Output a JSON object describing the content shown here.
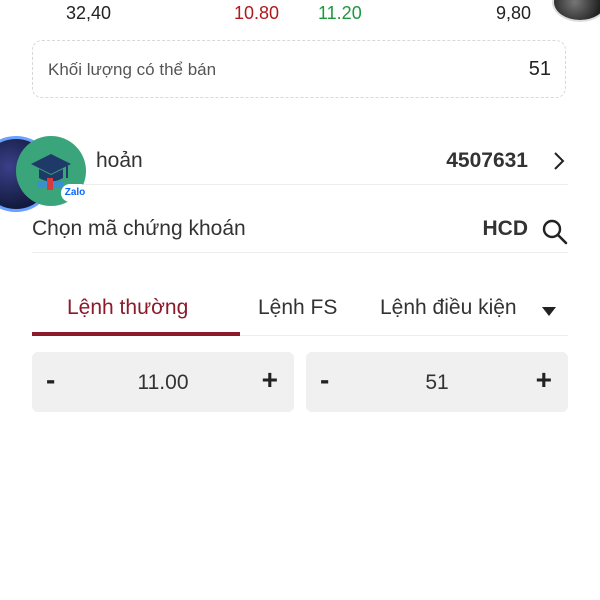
{
  "prices": {
    "left": "32,40",
    "red": "10.80",
    "green": "11.20",
    "right": "9,80"
  },
  "sellable": {
    "label": "Khối lượng có thể bán",
    "value": "51"
  },
  "account": {
    "label": "hoản",
    "value": "4507631"
  },
  "symbol": {
    "label": "Chọn mã chứng khoán",
    "value": "HCD"
  },
  "tabs": [
    {
      "label": "Lệnh thường",
      "active": true
    },
    {
      "label": "Lệnh FS",
      "active": false
    },
    {
      "label": "Lệnh điều kiện",
      "active": false
    }
  ],
  "price_stepper": {
    "minus": "-",
    "value": "11.00",
    "plus": "+"
  },
  "qty_stepper": {
    "minus": "-",
    "value": "51",
    "plus": "+"
  },
  "zalo": {
    "tag": "Zalo"
  },
  "colors": {
    "accent": "#8b1a2b",
    "red": "#b0191e",
    "green": "#1a9a3c",
    "zalo": "#3aa57a"
  }
}
